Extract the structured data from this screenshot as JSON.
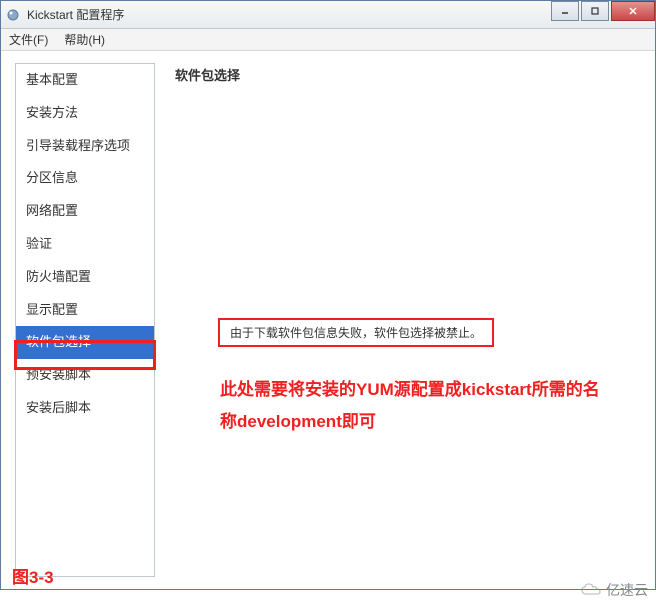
{
  "window": {
    "title": "Kickstart 配置程序"
  },
  "menu": {
    "file": "文件(F)",
    "help": "帮助(H)"
  },
  "sidebar": {
    "items": [
      {
        "label": "基本配置"
      },
      {
        "label": "安装方法"
      },
      {
        "label": "引导装载程序选项"
      },
      {
        "label": "分区信息"
      },
      {
        "label": "网络配置"
      },
      {
        "label": "验证"
      },
      {
        "label": "防火墙配置"
      },
      {
        "label": "显示配置"
      },
      {
        "label": "软件包选择"
      },
      {
        "label": "预安装脚本"
      },
      {
        "label": "安装后脚本"
      }
    ],
    "selected_index": 8
  },
  "main": {
    "title": "软件包选择",
    "error_message": "由于下载软件包信息失败，软件包选择被禁止。"
  },
  "annotation": {
    "text": "此处需要将安装的YUM源配置成kickstart所需的名称development即可",
    "figure_label": "图3-3"
  },
  "watermark": {
    "text": "亿速云"
  },
  "colors": {
    "highlight_red": "#f02020",
    "selection_blue": "#3470d0"
  }
}
